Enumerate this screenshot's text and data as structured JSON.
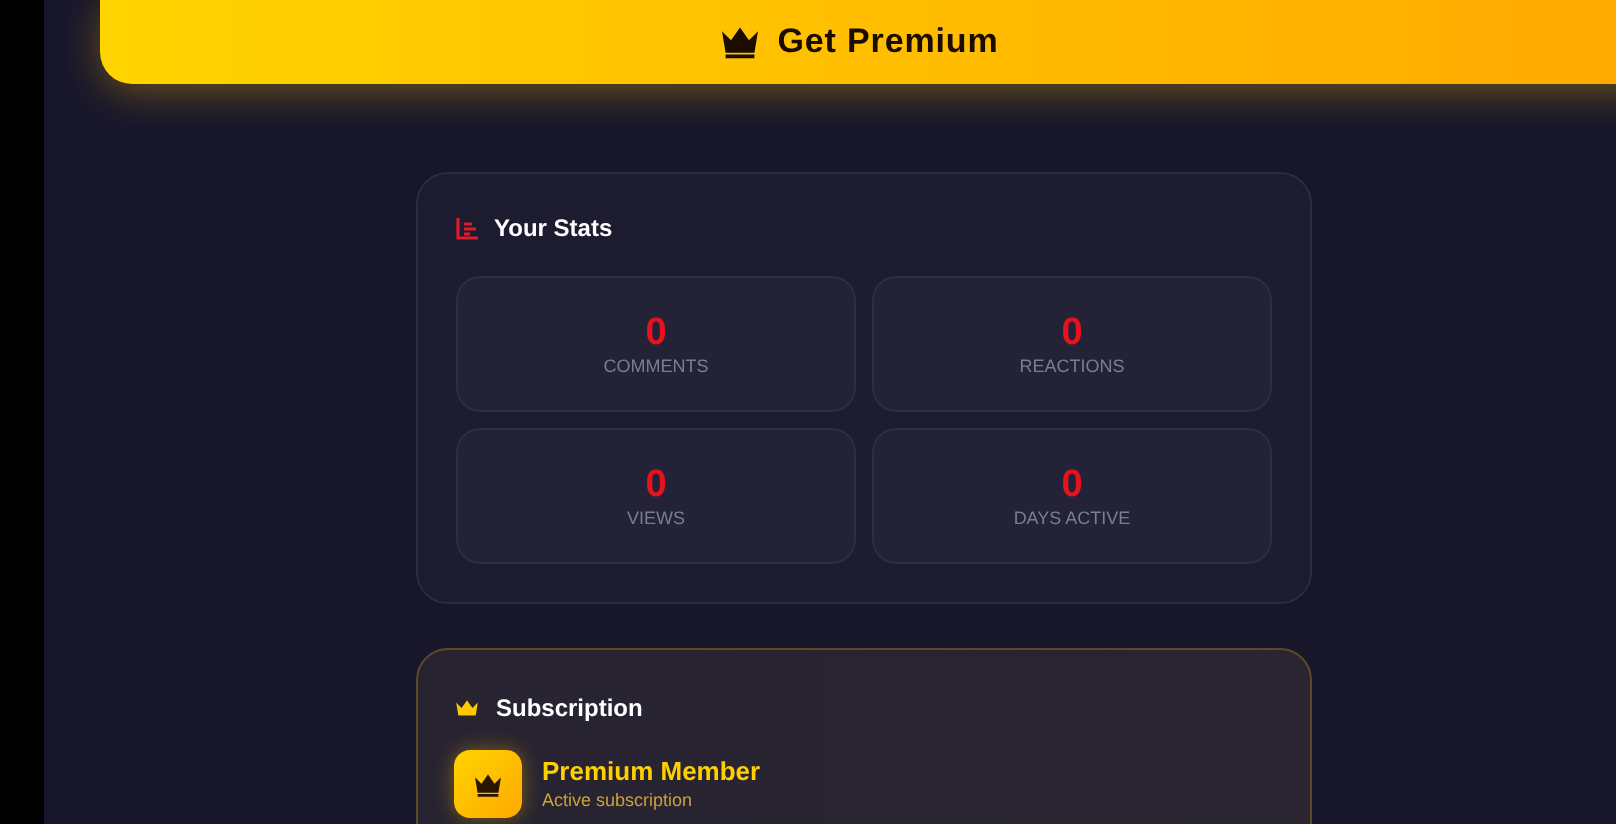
{
  "premium_button": {
    "label": "Get Premium"
  },
  "stats": {
    "title": "Your Stats",
    "items": [
      {
        "value": "0",
        "label": "COMMENTS"
      },
      {
        "value": "0",
        "label": "REACTIONS"
      },
      {
        "value": "0",
        "label": "VIEWS"
      },
      {
        "value": "0",
        "label": "DAYS ACTIVE"
      }
    ]
  },
  "subscription": {
    "title": "Subscription",
    "plan": "Premium Member",
    "status": "Active subscription"
  }
}
